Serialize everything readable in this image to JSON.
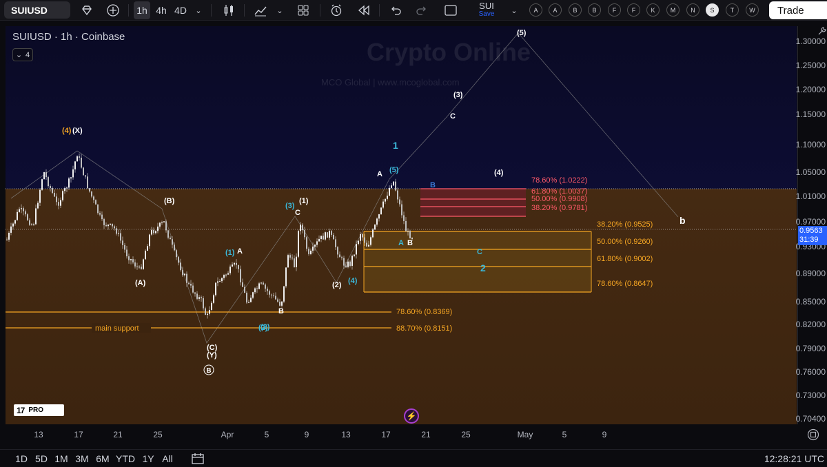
{
  "toolbar": {
    "symbol": "SUIUSD",
    "intervals": [
      {
        "label": "1h",
        "active": true
      },
      {
        "label": "4h",
        "active": false
      },
      {
        "label": "4D",
        "active": false
      }
    ],
    "icons": [
      "add-symbol-icon",
      "indicators-icon",
      "candle-style-icon",
      "chart-template-icon",
      "layout-icon",
      "alert-icon",
      "replay-icon",
      "undo-icon",
      "redo-icon",
      "fullscreen-icon"
    ],
    "watchlist": {
      "name": "SUI",
      "action": "Save"
    },
    "letters": [
      "A",
      "A",
      "B",
      "B",
      "F",
      "F",
      "K",
      "M",
      "N",
      "S",
      "T",
      "W"
    ],
    "selected_letter": "S",
    "trade_label": "Trade"
  },
  "legend": {
    "title": "SUIUSD · 1h · Coinbase",
    "indicator_count": "4"
  },
  "watermark": {
    "title": "Crypto Online",
    "subtitle": "MCO Global  |  www.mcoglobal.com"
  },
  "annotations": {
    "wave_labels": [
      {
        "text": "(4)",
        "color": "#f5a623"
      },
      {
        "text": "(X)",
        "color": "#ffffff"
      },
      {
        "text": "(B)",
        "color": "#ffffff"
      },
      {
        "text": "(A)",
        "color": "#ffffff"
      },
      {
        "text": "(C)",
        "color": "#ffffff"
      },
      {
        "text": "(Y)",
        "color": "#ffffff"
      },
      {
        "text": "B",
        "color": "#ffffff"
      },
      {
        "text": "(1)",
        "color": "#3bb8d9"
      },
      {
        "text": "A",
        "color": "#ffffff"
      },
      {
        "text": "B",
        "color": "#ffffff"
      },
      {
        "text": "(2)",
        "color": "#3bb8d9"
      },
      {
        "text": "(3)",
        "color": "#3bb8d9"
      },
      {
        "text": "(1)",
        "color": "#ffffff"
      },
      {
        "text": "C",
        "color": "#ffffff"
      },
      {
        "text": "(2)",
        "color": "#ffffff"
      },
      {
        "text": "(4)",
        "color": "#3bb8d9"
      },
      {
        "text": "A",
        "color": "#ffffff"
      },
      {
        "text": "(5)",
        "color": "#3bb8d9"
      },
      {
        "text": "1",
        "color": "#3bb8d9"
      },
      {
        "text": "A",
        "color": "#3bb8d9"
      },
      {
        "text": "B",
        "color": "#ffffff"
      },
      {
        "text": "B",
        "color": "#3b7bd9"
      },
      {
        "text": "C",
        "color": "#3bb8d9"
      },
      {
        "text": "2",
        "color": "#3bb8d9"
      },
      {
        "text": "(3)",
        "color": "#ffffff"
      },
      {
        "text": "C",
        "color": "#ffffff"
      },
      {
        "text": "(5)",
        "color": "#ffffff"
      },
      {
        "text": "(4)",
        "color": "#ffffff"
      },
      {
        "text": "b",
        "color": "#ffffff"
      },
      {
        "text": "B",
        "color": "#ffffff"
      }
    ],
    "main_support_label": "main support",
    "fib_levels": [
      {
        "label": "78.60% (1.0222)",
        "color": "#ff5a6a"
      },
      {
        "label": "61.80% (1.0037)",
        "color": "#ff5a6a"
      },
      {
        "label": "50.00% (0.9908)",
        "color": "#ff5a6a"
      },
      {
        "label": "38.20% (0.9781)",
        "color": "#ff5a6a"
      },
      {
        "label": "38.20% (0.9525)",
        "color": "#f5a623"
      },
      {
        "label": "50.00% (0.9260)",
        "color": "#f5a623"
      },
      {
        "label": "61.80% (0.9002)",
        "color": "#f5a623"
      },
      {
        "label": "78.60% (0.8647)",
        "color": "#f5a623"
      },
      {
        "label": "78.60% (0.8369)",
        "color": "#f5a623"
      },
      {
        "label": "88.70% (0.8151)",
        "color": "#f5a623"
      }
    ]
  },
  "price_axis": {
    "labels": [
      "1.30000",
      "1.25000",
      "1.20000",
      "1.15000",
      "1.10000",
      "1.05000",
      "1.01000",
      "0.97000",
      "0.93000",
      "0.89000",
      "0.85000",
      "0.82000",
      "0.79000",
      "0.76000",
      "0.73000",
      "0.70400"
    ],
    "current_price": "0.9563",
    "countdown": "31:39"
  },
  "time_axis": {
    "labels": [
      "13",
      "17",
      "21",
      "25",
      "Apr",
      "5",
      "9",
      "13",
      "17",
      "21",
      "25",
      "May",
      "5",
      "9"
    ]
  },
  "bottom_bar": {
    "ranges": [
      "1D",
      "5D",
      "1M",
      "3M",
      "6M",
      "YTD",
      "1Y",
      "All"
    ],
    "clock": "12:28:21 UTC"
  },
  "colors": {
    "background_top": "#0c0c2e",
    "background_bottom": "#3a2410",
    "candle_up": "#e8e8e8",
    "candle_down": "#e8e8e8",
    "fib_orange": "#f5a623",
    "fib_red": "#ff5a6a",
    "accent_blue": "#2962ff"
  }
}
